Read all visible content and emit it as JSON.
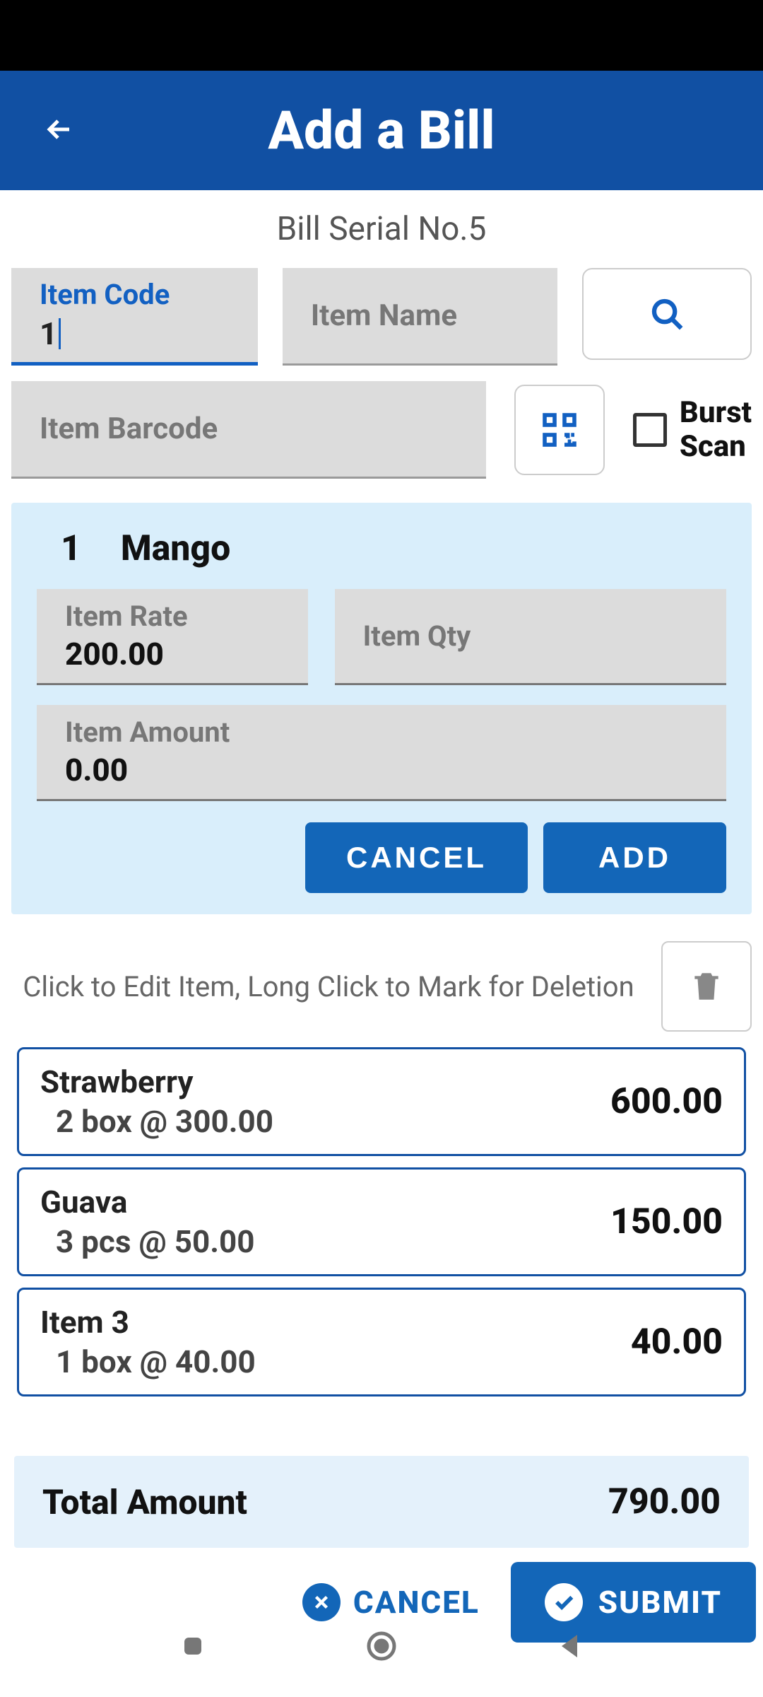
{
  "header": {
    "title": "Add a Bill"
  },
  "serial_text": "Bill Serial No.5",
  "fields": {
    "item_code_label": "Item Code",
    "item_code_value": "1",
    "item_name_label": "Item Name",
    "barcode_label": "Item Barcode",
    "burst_scan_label": "Burst\nScan"
  },
  "edit_panel": {
    "code": "1",
    "name": "Mango",
    "rate_label": "Item Rate",
    "rate_value": "200.00",
    "qty_label": "Item Qty",
    "amount_label": "Item Amount",
    "amount_value": "0.00",
    "cancel_label": "CANCEL",
    "add_label": "ADD"
  },
  "hint": "Click to Edit Item, Long Click to Mark for Deletion",
  "items": [
    {
      "name": "Strawberry",
      "detail": "2 box @ 300.00",
      "amount": "600.00"
    },
    {
      "name": "Guava",
      "detail": "3 pcs @ 50.00",
      "amount": "150.00"
    },
    {
      "name": "Item 3",
      "detail": "1 box @ 40.00",
      "amount": "40.00"
    }
  ],
  "total": {
    "label": "Total Amount",
    "value": "790.00"
  },
  "bottom": {
    "cancel": "CANCEL",
    "submit": "SUBMIT"
  }
}
